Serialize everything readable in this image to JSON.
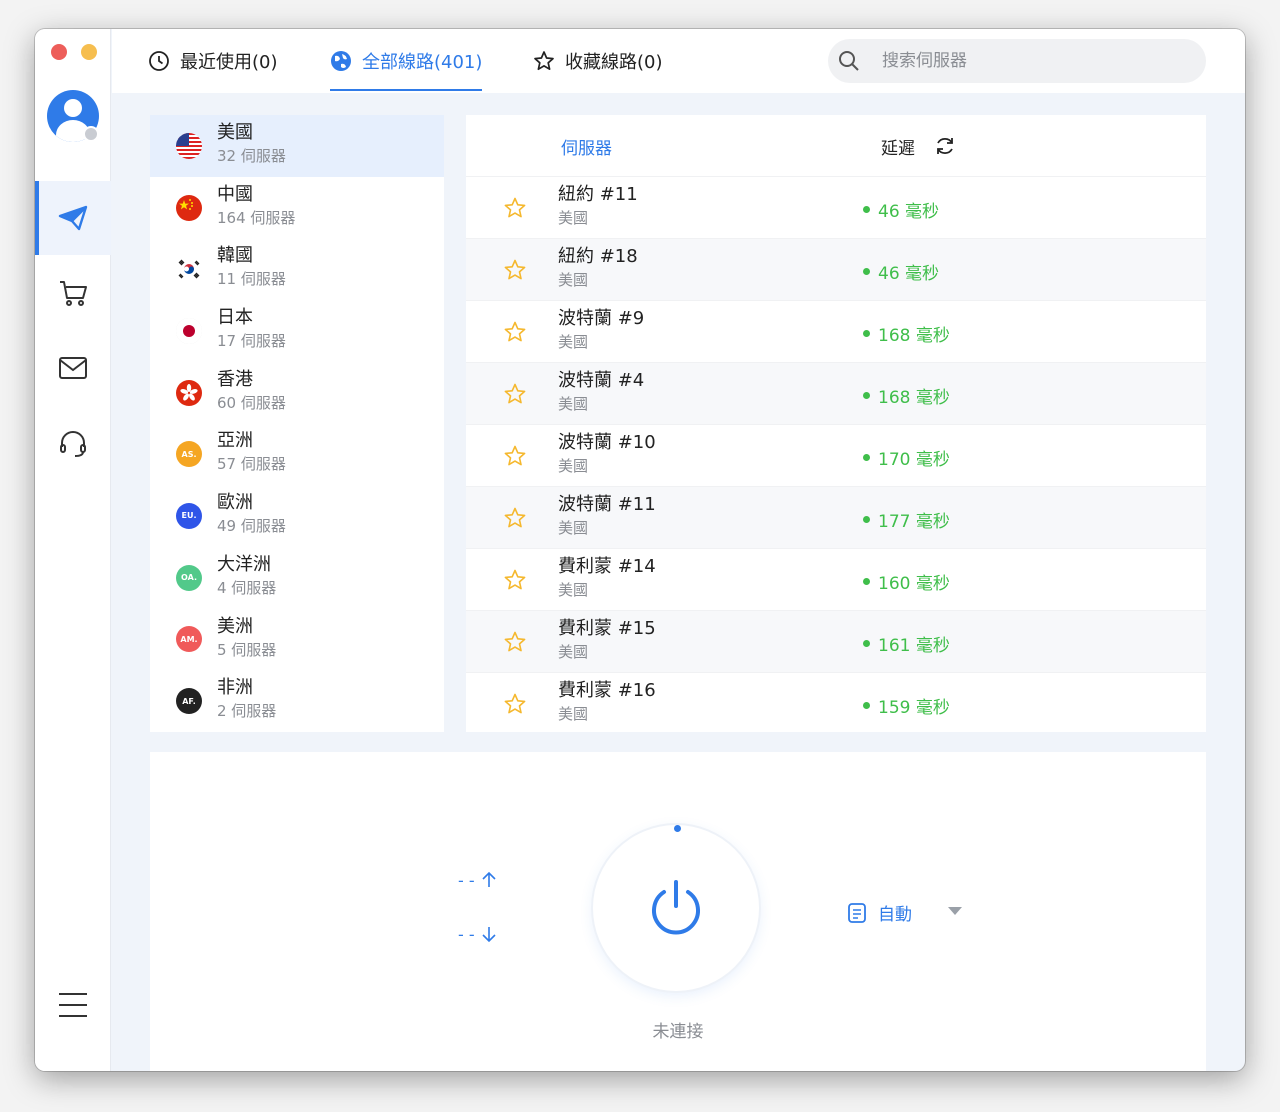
{
  "tabs": [
    {
      "label": "最近使用(0)",
      "icon": "clock-icon"
    },
    {
      "label": "全部線路(401)",
      "icon": "globe-icon"
    },
    {
      "label": "收藏線路(0)",
      "icon": "star-icon"
    }
  ],
  "search": {
    "placeholder": "搜索伺服器"
  },
  "regions": [
    {
      "name": "美國",
      "count": "32 伺服器",
      "flag": "us-flag-icon"
    },
    {
      "name": "中國",
      "count": "164 伺服器",
      "flag": "cn-flag-icon"
    },
    {
      "name": "韓國",
      "count": "11 伺服器",
      "flag": "kr-flag-icon"
    },
    {
      "name": "日本",
      "count": "17 伺服器",
      "flag": "jp-flag-icon"
    },
    {
      "name": "香港",
      "count": "60 伺服器",
      "flag": "hk-flag-icon"
    },
    {
      "name": "亞洲",
      "count": "57 伺服器",
      "badge": "AS.",
      "color": "#f5a623"
    },
    {
      "name": "歐洲",
      "count": "49 伺服器",
      "badge": "EU.",
      "color": "#2f55e8"
    },
    {
      "name": "大洋洲",
      "count": "4 伺服器",
      "badge": "OA.",
      "color": "#52c98a"
    },
    {
      "name": "美洲",
      "count": "5 伺服器",
      "badge": "AM.",
      "color": "#f05a5a"
    },
    {
      "name": "非洲",
      "count": "2 伺服器",
      "badge": "AF.",
      "color": "#222222"
    }
  ],
  "server_table": {
    "col_server": "伺服器",
    "col_latency": "延遲",
    "rows": [
      {
        "name": "紐約 #11",
        "location": "美國",
        "latency": "46 毫秒"
      },
      {
        "name": "紐約 #18",
        "location": "美國",
        "latency": "46 毫秒"
      },
      {
        "name": "波特蘭 #9",
        "location": "美國",
        "latency": "168 毫秒"
      },
      {
        "name": "波特蘭 #4",
        "location": "美國",
        "latency": "168 毫秒"
      },
      {
        "name": "波特蘭 #10",
        "location": "美國",
        "latency": "170 毫秒"
      },
      {
        "name": "波特蘭 #11",
        "location": "美國",
        "latency": "177 毫秒"
      },
      {
        "name": "費利蒙 #14",
        "location": "美國",
        "latency": "160 毫秒"
      },
      {
        "name": "費利蒙 #15",
        "location": "美國",
        "latency": "161 毫秒"
      },
      {
        "name": "費利蒙 #16",
        "location": "美國",
        "latency": "159 毫秒"
      }
    ]
  },
  "connection": {
    "upload": "- -",
    "download": "- -",
    "status": "未連接",
    "mode": "自動"
  },
  "colors": {
    "accent": "#2f7be8",
    "latency_good": "#3fbe4a"
  }
}
